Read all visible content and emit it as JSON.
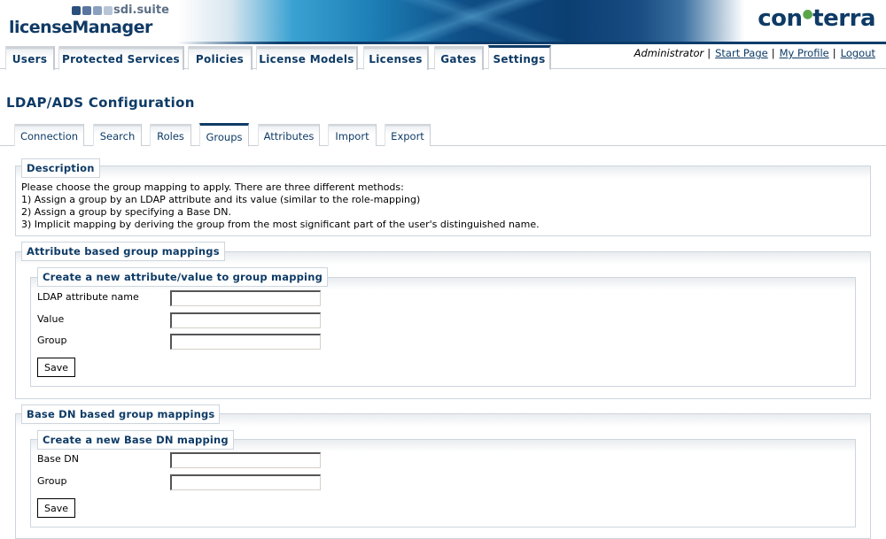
{
  "header": {
    "suite_name": "sdi.suite",
    "app_name": "licenseManager",
    "vendor_logo": "con•terra",
    "vendor_logo_left": "con",
    "vendor_logo_right": "terra",
    "brand_dot_colors": [
      "#2b4f7d",
      "#5a76a0",
      "#8aa0bf",
      "#b8c5d6"
    ]
  },
  "main_nav": {
    "tabs": [
      {
        "label": "Users",
        "active": false
      },
      {
        "label": "Protected Services",
        "active": false
      },
      {
        "label": "Policies",
        "active": false
      },
      {
        "label": "License Models",
        "active": false
      },
      {
        "label": "Licenses",
        "active": false
      },
      {
        "label": "Gates",
        "active": false
      },
      {
        "label": "Settings",
        "active": true
      }
    ]
  },
  "user_bar": {
    "role": "Administrator",
    "links": [
      "Start Page",
      "My Profile",
      "Logout"
    ],
    "separator": "|"
  },
  "page": {
    "title": "LDAP/ADS Configuration"
  },
  "sub_nav": {
    "tabs": [
      {
        "label": "Connection",
        "active": false
      },
      {
        "label": "Search",
        "active": false
      },
      {
        "label": "Roles",
        "active": false
      },
      {
        "label": "Groups",
        "active": true
      },
      {
        "label": "Attributes",
        "active": false
      },
      {
        "label": "Import",
        "active": false
      },
      {
        "label": "Export",
        "active": false
      }
    ]
  },
  "description": {
    "legend": "Description",
    "lines": [
      "Please choose the group mapping to apply. There are three different methods:",
      "1) Assign a group by an LDAP attribute and its value (similar to the role-mapping)",
      "2) Assign a group by specifying a Base DN.",
      "3) Implicit mapping by deriving the group from the most significant part of the user's distinguished name."
    ]
  },
  "attribute_mappings": {
    "legend": "Attribute based group mappings",
    "create": {
      "legend": "Create a new attribute/value to group mapping",
      "fields": [
        {
          "label": "LDAP attribute name",
          "value": ""
        },
        {
          "label": "Value",
          "value": ""
        },
        {
          "label": "Group",
          "value": ""
        }
      ],
      "save_label": "Save"
    }
  },
  "basedn_mappings": {
    "legend": "Base DN based group mappings",
    "create": {
      "legend": "Create a new Base DN mapping",
      "fields": [
        {
          "label": "Base DN",
          "value": ""
        },
        {
          "label": "Group",
          "value": ""
        }
      ],
      "save_label": "Save"
    }
  },
  "colors": {
    "brand_navy": "#0e3b66",
    "border": "#cdd5dd",
    "accent_green": "#5aa548"
  }
}
